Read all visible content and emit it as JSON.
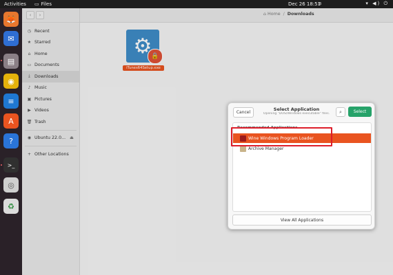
{
  "topbar": {
    "activities": "Activities",
    "app_name": "Files",
    "clock": "Dec 26  18:51",
    "status_icons": "▾ ◀) ⏻"
  },
  "dock": [
    {
      "name": "firefox-icon",
      "glyph": "🦊",
      "bg": "#e8772e"
    },
    {
      "name": "thunderbird-icon",
      "glyph": "✉",
      "bg": "#2f6ed3"
    },
    {
      "name": "files-icon",
      "glyph": "▤",
      "bg": "#8a7f86"
    },
    {
      "name": "rhythmbox-icon",
      "glyph": "◉",
      "bg": "#e5b20b"
    },
    {
      "name": "writer-icon",
      "glyph": "≡",
      "bg": "#1f78d1"
    },
    {
      "name": "app-center-icon",
      "glyph": "A",
      "bg": "#e95420"
    },
    {
      "name": "help-icon",
      "glyph": "?",
      "bg": "#2a74d8"
    },
    {
      "name": "terminal-icon",
      "glyph": ">_",
      "bg": "#303030"
    },
    {
      "name": "disc-icon",
      "glyph": "◎",
      "bg": "#cfcfcf"
    },
    {
      "name": "trash-icon",
      "glyph": "♻",
      "bg": "#dcdcdc"
    }
  ],
  "sidebar": {
    "items": [
      {
        "label": "Recent",
        "icon": "◷"
      },
      {
        "label": "Starred",
        "icon": "★"
      },
      {
        "label": "Home",
        "icon": "⌂"
      },
      {
        "label": "Documents",
        "icon": "▭"
      },
      {
        "label": "Downloads",
        "icon": "⤓"
      },
      {
        "label": "Music",
        "icon": "♪"
      },
      {
        "label": "Pictures",
        "icon": "▣"
      },
      {
        "label": "Videos",
        "icon": "▶"
      },
      {
        "label": "Trash",
        "icon": "🗑"
      },
      {
        "label": "Ubuntu 22.0...",
        "icon": "◉"
      },
      {
        "label": "Other Locations",
        "icon": "+"
      }
    ]
  },
  "breadcrumb": {
    "home": "Home",
    "separator": "/",
    "current": "Downloads"
  },
  "file": {
    "name": "iTunes64Setup.exe"
  },
  "dialog": {
    "cancel": "Cancel",
    "title": "Select Application",
    "subtitle": "Opening \"DOS/Windows executable\" files.",
    "select": "Select",
    "section_header": "Recommended Applications",
    "apps": [
      {
        "label": "Wine Windows Program Loader",
        "icon_color": "#9c1b1b"
      },
      {
        "label": "Archive Manager",
        "icon_color": "#c9b48a"
      }
    ],
    "view_all": "View All Applications"
  }
}
